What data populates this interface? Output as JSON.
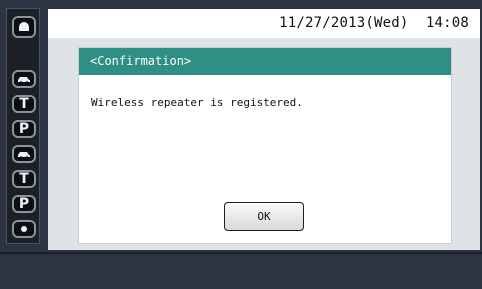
{
  "header": {
    "date": "11/27/2013",
    "weekday": "(Wed)",
    "time": "14:08"
  },
  "sidebar": {
    "buttons": [
      {
        "id": "home",
        "label": ""
      },
      {
        "id": "car-1",
        "label": ""
      },
      {
        "id": "t-1",
        "label": "T"
      },
      {
        "id": "p-1",
        "label": "P"
      },
      {
        "id": "car-2",
        "label": ""
      },
      {
        "id": "t-2",
        "label": "T"
      },
      {
        "id": "p-2",
        "label": "P"
      },
      {
        "id": "dot",
        "label": ""
      }
    ]
  },
  "dialog": {
    "title": "<Confirmation>",
    "message": "Wireless repeater is registered.",
    "ok_label": "OK"
  },
  "colors": {
    "teal_header": "#2f8f84",
    "screen_bg": "#2b3440",
    "panel_bg": "#dfe3e6"
  }
}
